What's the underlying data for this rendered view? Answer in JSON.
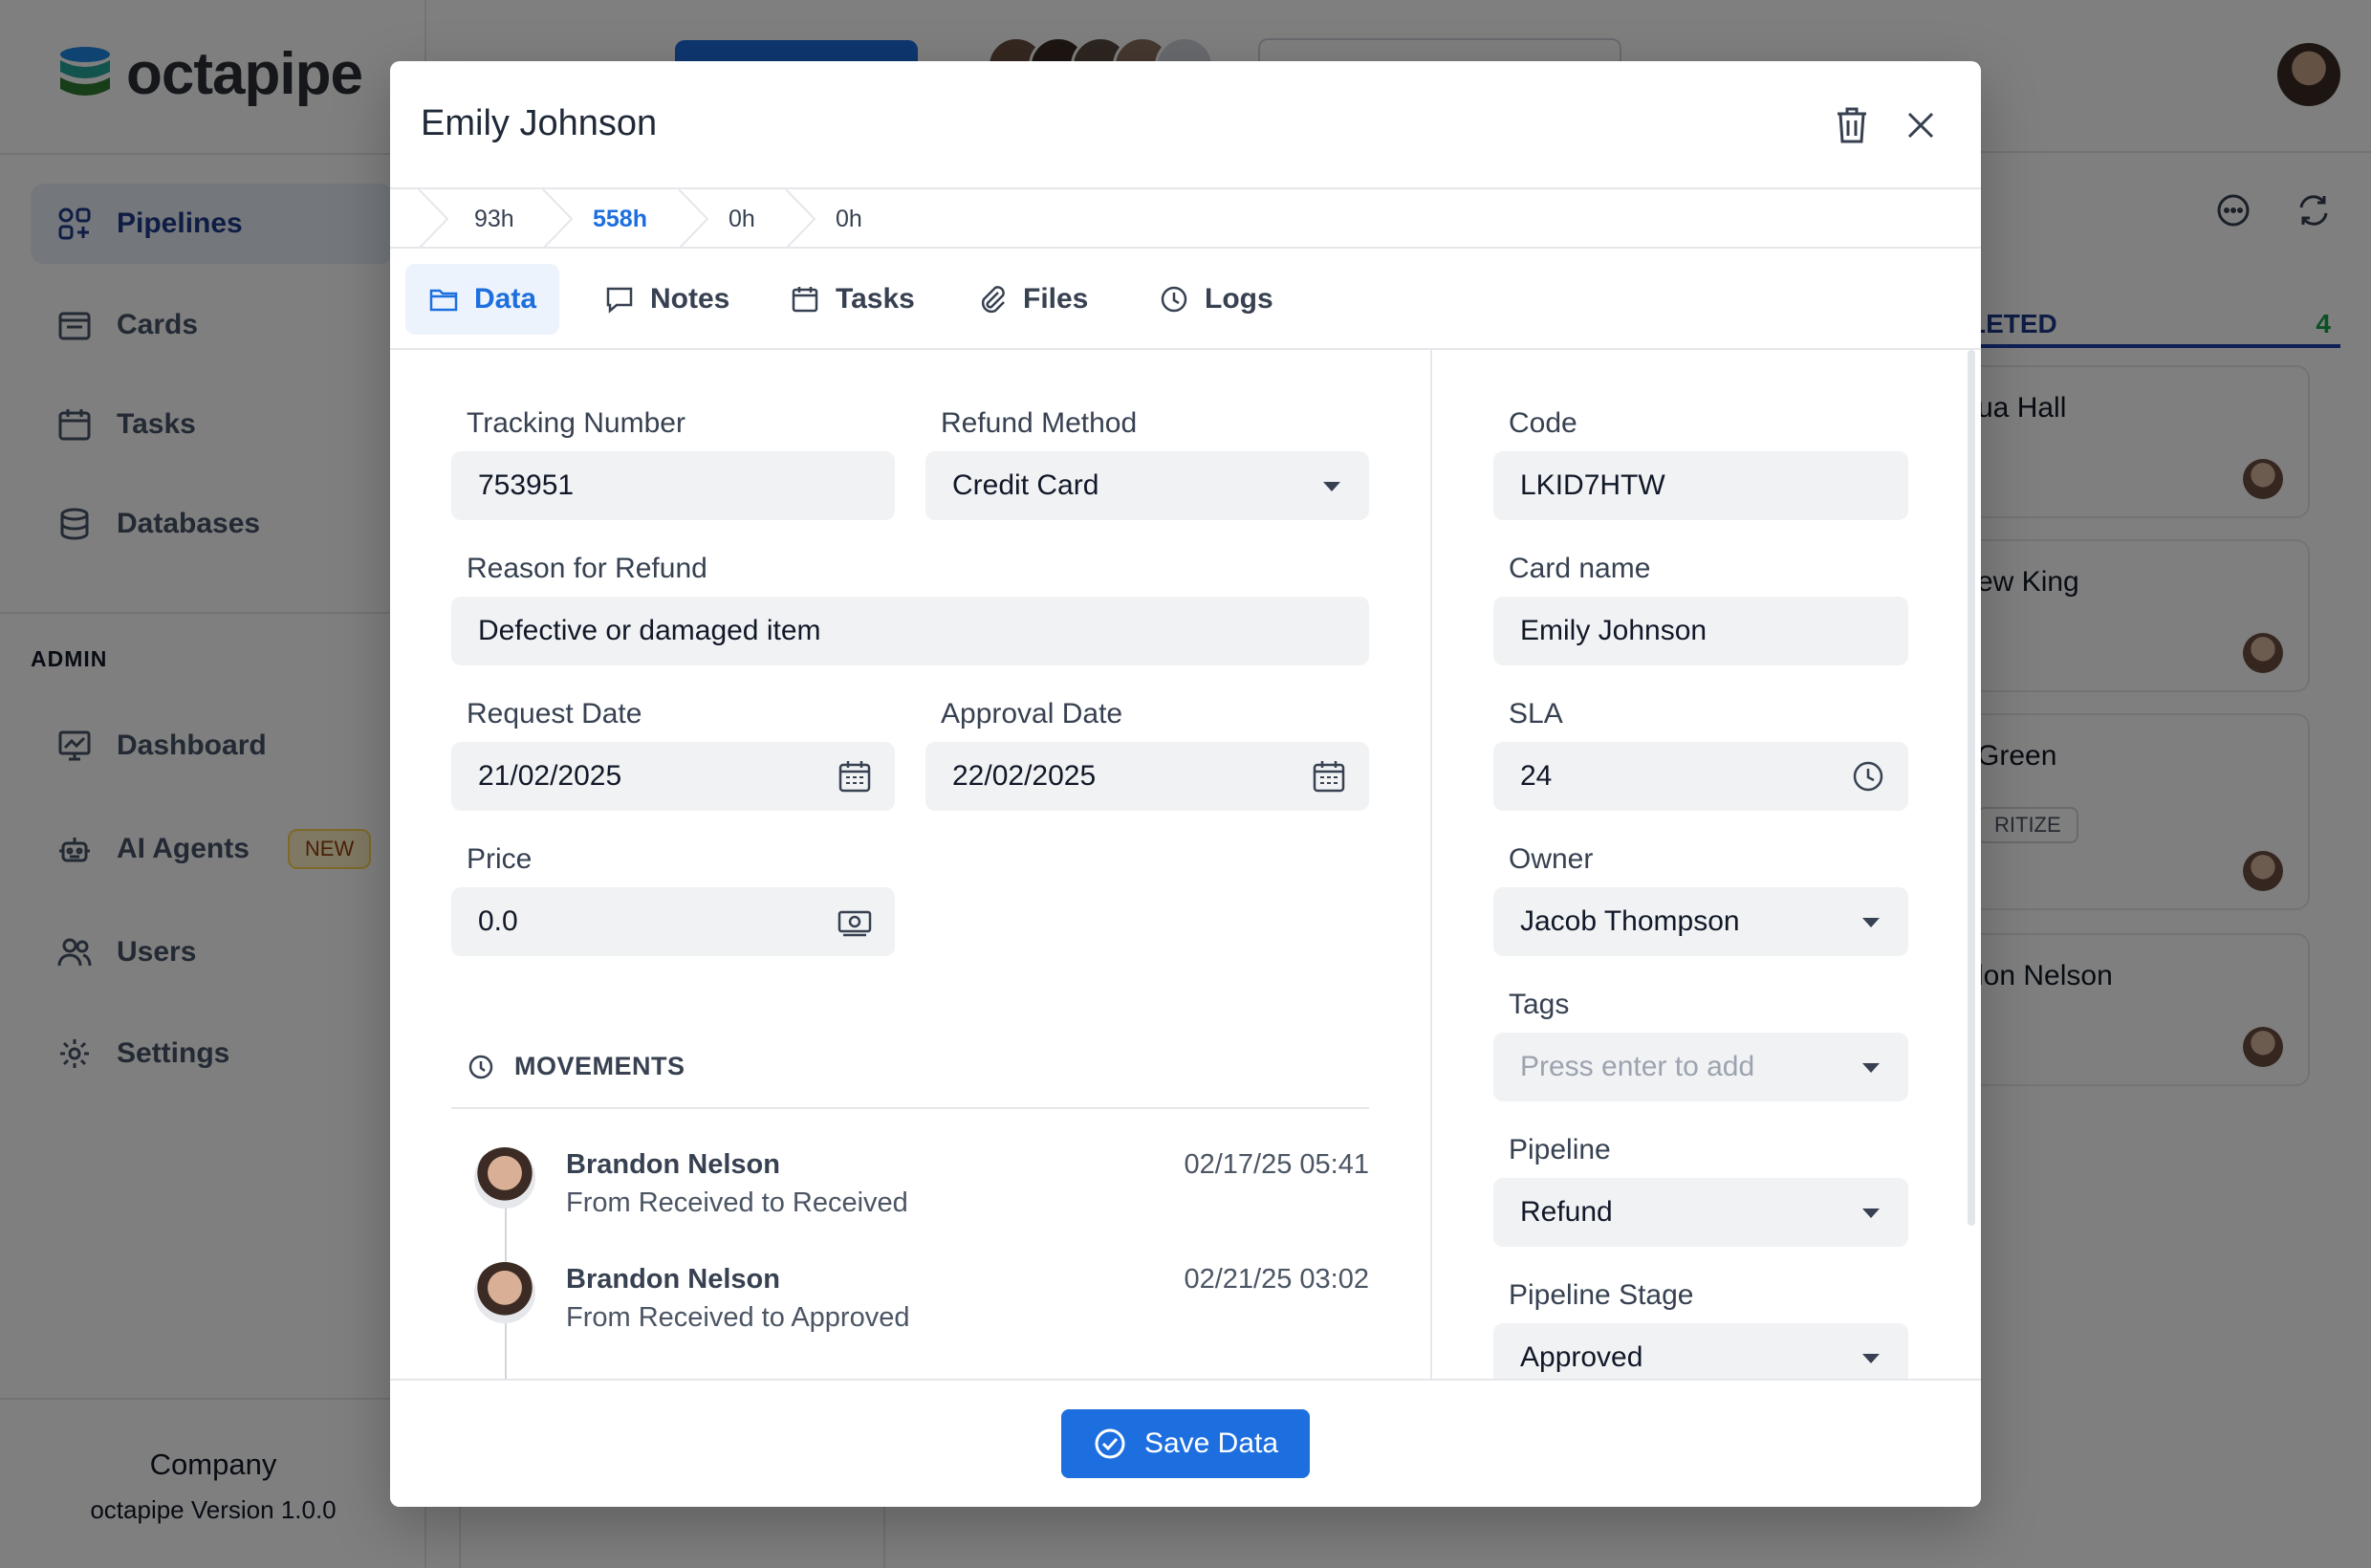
{
  "app": {
    "brand": "octapipe",
    "nav": [
      {
        "label": "Pipelines",
        "icon": "pipelines-icon",
        "active": true
      },
      {
        "label": "Cards",
        "icon": "cards-icon"
      },
      {
        "label": "Tasks",
        "icon": "calendar-icon"
      },
      {
        "label": "Databases",
        "icon": "database-icon"
      }
    ],
    "admin_label": "ADMIN",
    "admin_nav": [
      {
        "label": "Dashboard",
        "icon": "dashboard-icon"
      },
      {
        "label": "AI Agents",
        "icon": "robot-icon",
        "badge": "NEW"
      },
      {
        "label": "Users",
        "icon": "users-icon"
      },
      {
        "label": "Settings",
        "icon": "gear-icon"
      }
    ],
    "footer": {
      "company": "Company",
      "version": "octapipe Version 1.0.0"
    },
    "column": {
      "title": "LETED",
      "count": "4"
    },
    "bg_cards": [
      {
        "name": "ua Hall"
      },
      {
        "name": "ew King"
      },
      {
        "name": "Green",
        "tag": "RITIZE"
      },
      {
        "name": "lon Nelson"
      }
    ]
  },
  "modal": {
    "title": "Emily Johnson",
    "stages": [
      {
        "label": "93h",
        "active": false
      },
      {
        "label": "558h",
        "active": true
      },
      {
        "label": "0h",
        "active": false
      },
      {
        "label": "0h",
        "active": false
      }
    ],
    "tabs": [
      {
        "label": "Data",
        "icon": "folder-icon",
        "active": true
      },
      {
        "label": "Notes",
        "icon": "chat-icon"
      },
      {
        "label": "Tasks",
        "icon": "calendar-icon"
      },
      {
        "label": "Files",
        "icon": "paperclip-icon"
      },
      {
        "label": "Logs",
        "icon": "clock-icon"
      }
    ],
    "left": {
      "tracking_number": {
        "label": "Tracking Number",
        "value": "753951"
      },
      "refund_method": {
        "label": "Refund Method",
        "value": "Credit Card"
      },
      "reason": {
        "label": "Reason for Refund",
        "value": "Defective or damaged item"
      },
      "request_date": {
        "label": "Request Date",
        "value": "21/02/2025"
      },
      "approval_date": {
        "label": "Approval Date",
        "value": "22/02/2025"
      },
      "price": {
        "label": "Price",
        "value": "0.0"
      }
    },
    "movements": {
      "title": "MOVEMENTS",
      "items": [
        {
          "name": "Brandon Nelson",
          "desc": "From Received to Received",
          "time": "02/17/25 05:41"
        },
        {
          "name": "Brandon Nelson",
          "desc": "From Received to Approved",
          "time": "02/21/25 03:02"
        }
      ]
    },
    "right": {
      "code": {
        "label": "Code",
        "value": "LKID7HTW"
      },
      "card_name": {
        "label": "Card name",
        "value": "Emily Johnson"
      },
      "sla": {
        "label": "SLA",
        "value": "24"
      },
      "owner": {
        "label": "Owner",
        "value": "Jacob Thompson"
      },
      "tags": {
        "label": "Tags",
        "placeholder": "Press enter to add"
      },
      "pipeline": {
        "label": "Pipeline",
        "value": "Refund"
      },
      "pipeline_stage": {
        "label": "Pipeline Stage",
        "value": "Approved"
      }
    },
    "save_label": "Save Data"
  },
  "colors": {
    "accent": "#1d6fe0",
    "overlay": "rgba(0,0,0,0.5)",
    "success": "#16a34a"
  }
}
